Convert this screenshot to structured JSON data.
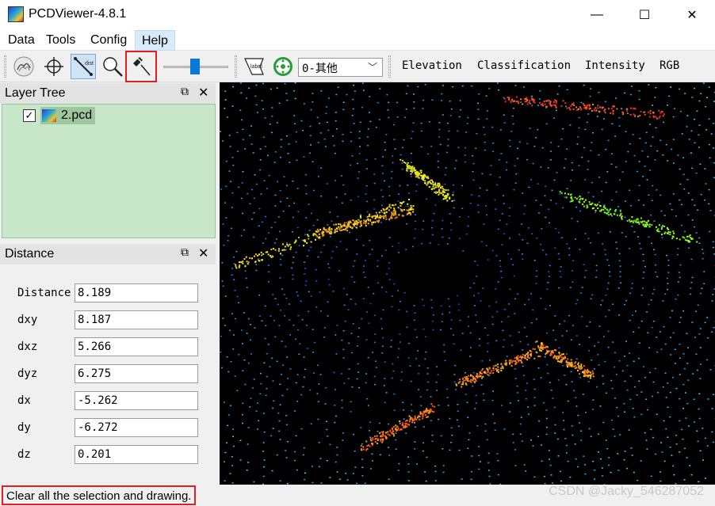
{
  "window": {
    "title": "PCDViewer-4.8.1",
    "min_glyph": "—",
    "max_glyph": "☐",
    "close_glyph": "✕"
  },
  "menu": {
    "items": [
      "Data",
      "Tools",
      "Config",
      "Help"
    ]
  },
  "toolbar": {
    "icons": [
      "cloud-icon",
      "crosshair-icon",
      "distance-icon",
      "zoom-icon",
      "clear-brush-icon",
      "label-icon",
      "color-wheel-icon"
    ],
    "dist_icon_text": "dist",
    "label_icon_text": "label",
    "classification_combo": "0-其他",
    "combo_arrow": "﹀",
    "modes": [
      "Elevation",
      "Classification",
      "Intensity",
      "RGB"
    ],
    "slider_value": 0.5,
    "highlight_color": "#e02020"
  },
  "layer_tree": {
    "title": "Layer Tree",
    "float_glyph": "⧉",
    "close_glyph": "✕",
    "items": [
      {
        "label": "2.pcd",
        "checked_glyph": "✓"
      }
    ]
  },
  "distance_panel": {
    "title": "Distance",
    "float_glyph": "⧉",
    "close_glyph": "✕",
    "fields": [
      {
        "label": "Distance",
        "value": "8.189"
      },
      {
        "label": "dxy",
        "value": "8.187"
      },
      {
        "label": "dxz",
        "value": "5.266"
      },
      {
        "label": "dyz",
        "value": "6.275"
      },
      {
        "label": "dx",
        "value": "-5.262"
      },
      {
        "label": "dy",
        "value": "-6.272"
      },
      {
        "label": "dz",
        "value": "0.201"
      }
    ]
  },
  "status": {
    "message": "Clear all the selection and drawing.",
    "watermark": "CSDN @Jacky_546287052"
  }
}
